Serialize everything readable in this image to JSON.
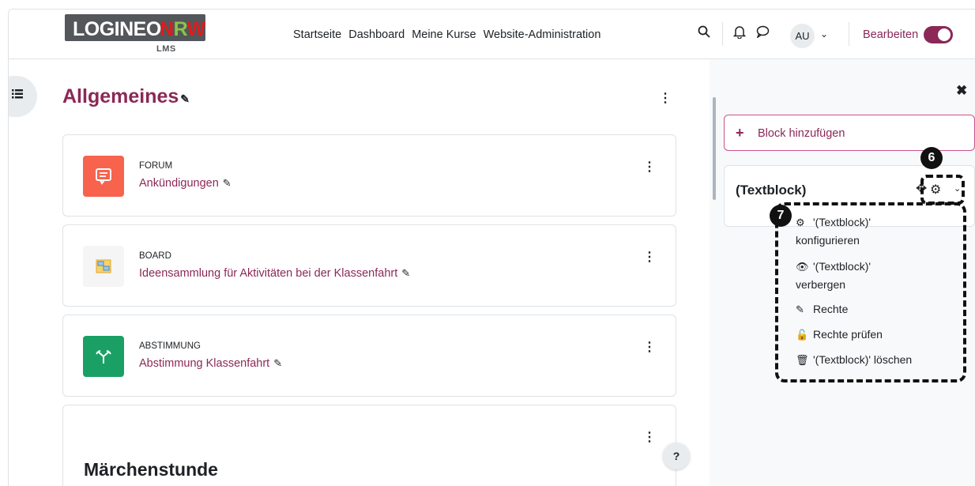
{
  "navbar": {
    "logo_part1": "LOGINEO",
    "logo_part2_n": "N",
    "logo_part2_r": "R",
    "logo_part2_w": "W",
    "logo_sub": "LMS",
    "links": [
      "Startseite",
      "Dashboard",
      "Meine Kurse",
      "Website-Administration"
    ],
    "avatar_initials": "AU",
    "edit_label": "Bearbeiten",
    "edit_mode_on": true
  },
  "section": {
    "title": "Allgemeines"
  },
  "activities": [
    {
      "type": "FORUM",
      "name": "Ankündigungen",
      "icon": "forum-icon",
      "color": "#f7634d"
    },
    {
      "type": "BOARD",
      "name": "Ideensammlung für Aktivitäten bei der Klassenfahrt",
      "icon": "board-icon",
      "color": "#f5f5f5"
    },
    {
      "type": "ABSTIMMUNG",
      "name": "Abstimmung Klassenfahrt",
      "icon": "choice-icon",
      "color": "#1aa064"
    }
  ],
  "label_card": {
    "title": "Märchenstunde"
  },
  "help": "?",
  "drawer": {
    "add_block": "Block hinzufügen",
    "block_title": "(Textblock)"
  },
  "badges": {
    "b6": "6",
    "b7": "7"
  },
  "block_menu": {
    "items": [
      {
        "icon": "gear-icon",
        "line1": "'(Textblock)'",
        "line2": "konfigurieren"
      },
      {
        "icon": "eye-icon",
        "line1": "'(Textblock)'",
        "line2": "verbergen"
      },
      {
        "icon": "edit-icon",
        "line1": "Rechte",
        "line2": ""
      },
      {
        "icon": "unlock-icon",
        "line1": "Rechte prüfen",
        "line2": ""
      },
      {
        "icon": "trash-icon",
        "line1": "'(Textblock)' löschen",
        "line2": ""
      }
    ]
  },
  "colors": {
    "brand": "#8b2857",
    "border": "#dee2e6"
  }
}
